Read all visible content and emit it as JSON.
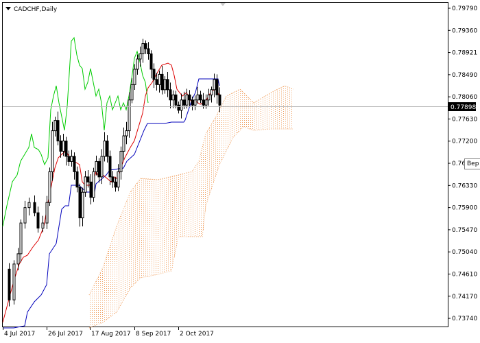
{
  "chart_title": "CADCHF,Daily",
  "price_tag": "0.77898",
  "tooltip_text": "Вер",
  "chart_data": {
    "type": "candlestick",
    "symbol": "CADCHF",
    "timeframe": "Daily",
    "current_price": 0.77898,
    "y_ticks": [
      "0.79790",
      "0.79360",
      "0.78921",
      "0.78490",
      "0.78060",
      "0.77630",
      "0.77200",
      "0.76760",
      "0.76330",
      "0.75900",
      "0.75470",
      "0.75040",
      "0.74610",
      "0.74170",
      "0.73740"
    ],
    "x_ticks": [
      "4 Jul 2017",
      "26 Jul 2017",
      "17 Aug 2017",
      "8 Sep 2017",
      "2 Oct 2017"
    ],
    "ylim": [
      0.7366,
      0.7985
    ],
    "grid": false,
    "indicator": "Ichimoku Kinko Hyo",
    "series": [
      {
        "name": "Tenkan-sen",
        "color": "#dd0000"
      },
      {
        "name": "Kijun-sen",
        "color": "#0000bb"
      },
      {
        "name": "Chikou Span",
        "color": "#00cc00"
      },
      {
        "name": "Kumo",
        "color": "#f0a060"
      }
    ]
  }
}
